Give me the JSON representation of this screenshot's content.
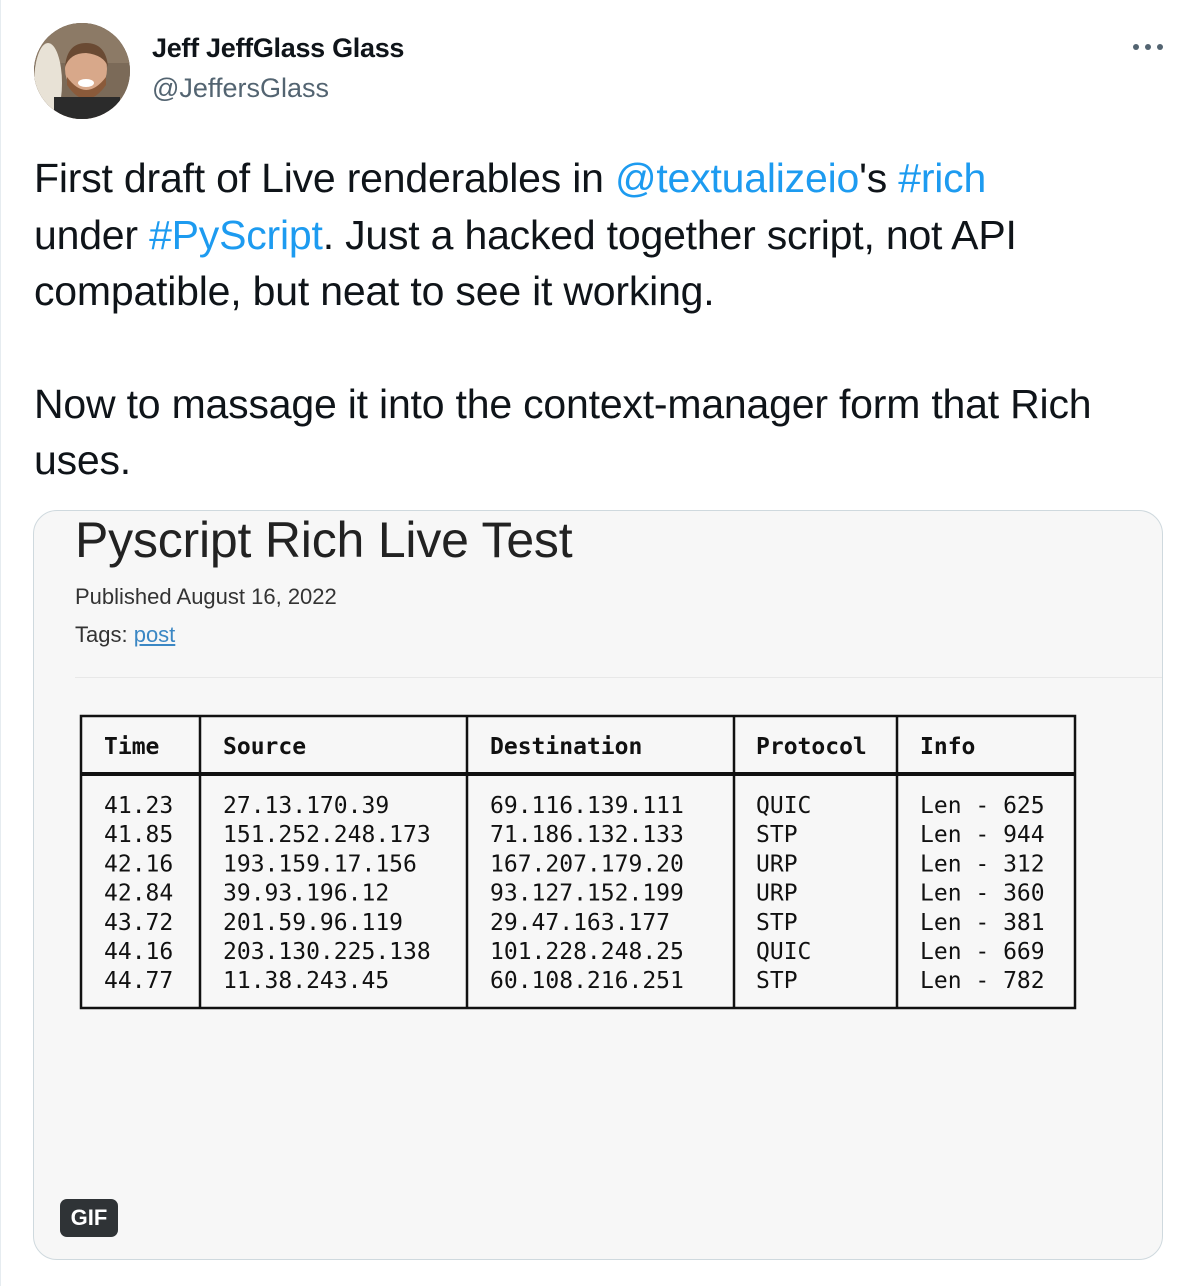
{
  "author": {
    "name": "Jeff JeffGlass Glass",
    "handle": "@JeffersGlass"
  },
  "tweet": {
    "line1_prefix": "First draft of Live renderables in ",
    "mention": "@textualizeio",
    "line1_mid": "'s ",
    "hashtag1": "#rich",
    "line2_prefix": "under ",
    "hashtag2": "#PyScript",
    "line2_rest": ". Just a hacked together script, not API compatible, but neat to see it working.",
    "paragraph2": "Now to massage it into the context-manager form that Rich uses."
  },
  "media": {
    "page_title": "Pyscript Rich Live Test",
    "published": "Published August 16, 2022",
    "tags_label": "Tags: ",
    "tag": "post",
    "badge": "GIF",
    "table": {
      "headers": [
        "Time",
        "Source",
        "Destination",
        "Protocol",
        "Info"
      ],
      "rows": [
        [
          "41.23",
          "27.13.170.39",
          "69.116.139.111",
          "QUIC",
          "Len - 625"
        ],
        [
          "41.85",
          "151.252.248.173",
          "71.186.132.133",
          "STP",
          "Len - 944"
        ],
        [
          "42.16",
          "193.159.17.156",
          "167.207.179.20",
          "URP",
          "Len - 312"
        ],
        [
          "42.84",
          "39.93.196.12",
          "93.127.152.199",
          "URP",
          "Len - 360"
        ],
        [
          "43.72",
          "201.59.96.119",
          "29.47.163.177",
          "STP",
          "Len - 381"
        ],
        [
          "44.16",
          "203.130.225.138",
          "101.228.248.25",
          "QUIC",
          "Len - 669"
        ],
        [
          "44.77",
          "11.38.243.45",
          "60.108.216.251",
          "STP",
          "Len - 782"
        ]
      ]
    }
  },
  "icons": {
    "more": "more-horizontal-icon"
  },
  "colors": {
    "link": "#1d9bf0",
    "text": "#0f1419",
    "secondary": "#536471",
    "card_border": "#cfd9de"
  }
}
